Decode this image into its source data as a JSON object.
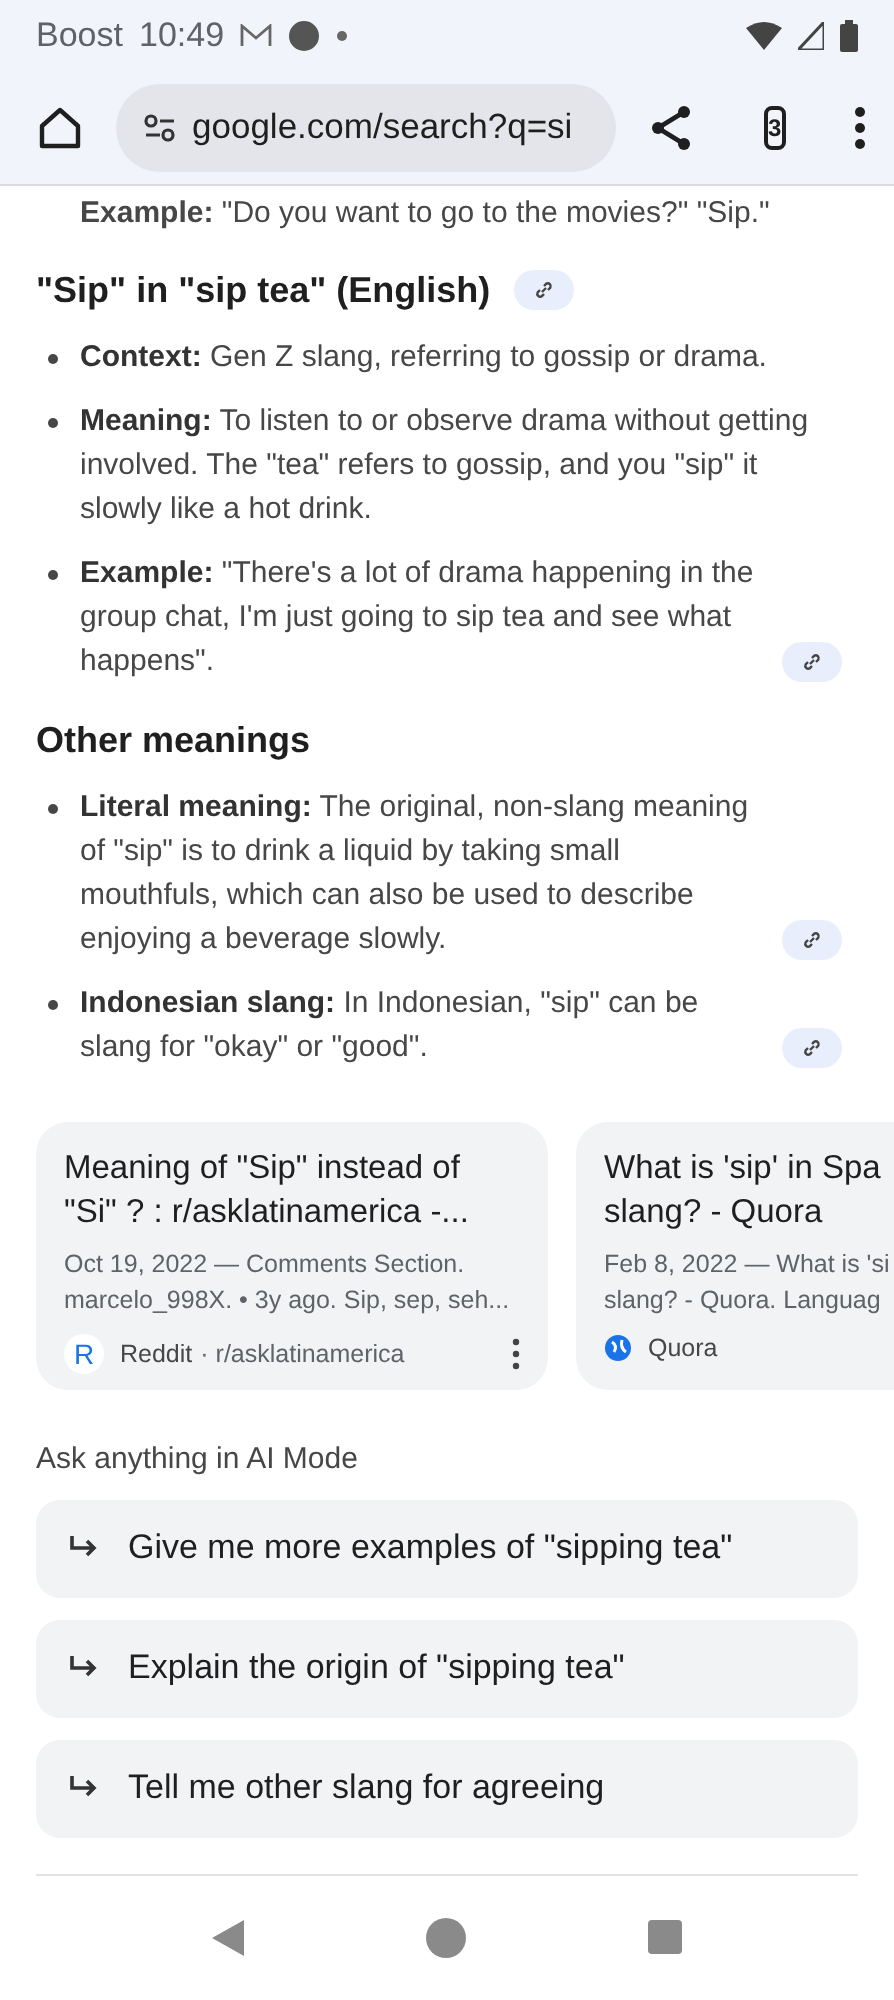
{
  "status_bar": {
    "carrier": "Boost",
    "time": "10:49"
  },
  "browser": {
    "url": "google.com/search?q=si",
    "tab_count": "3"
  },
  "partial_line": {
    "label": "Example:",
    "text": "\"Do you want to go to the movies?\" \"Sip.\""
  },
  "sections": [
    {
      "heading": "\"Sip\" in \"sip tea\" (English)",
      "link": true,
      "items": [
        {
          "label": "Context:",
          "text": "Gen Z slang, referring to gossip or drama.",
          "link": false
        },
        {
          "label": "Meaning:",
          "text": "To listen to or observe drama without getting involved. The \"tea\" refers to gossip, and you \"sip\" it slowly like a hot drink.",
          "link": false
        },
        {
          "label": "Example:",
          "text": "\"There's a lot of drama happening in the group chat, I'm just going to sip tea and see what happens\".",
          "link": true
        }
      ]
    },
    {
      "heading": "Other meanings",
      "link": false,
      "items": [
        {
          "label": "Literal meaning:",
          "text": "The original, non-slang meaning of \"sip\" is to drink a liquid by taking small mouthfuls, which can also be used to describe enjoying a beverage slowly.",
          "link": true
        },
        {
          "label": "Indonesian slang:",
          "text": "In Indonesian, \"sip\" can be slang for \"okay\" or \"good\".",
          "link": true
        }
      ]
    }
  ],
  "cards": [
    {
      "title": [
        "Meaning of \"Sip\" instead of",
        "\"Si\" ? : r/asklatinamerica -..."
      ],
      "snippet": [
        "Oct 19, 2022 — Comments Section.",
        "marcelo_998X. • 3y ago. Sip, sep, seh..."
      ],
      "source": "Reddit",
      "source_path": "· r/asklatinamerica",
      "favicon": "R",
      "kind": "letter",
      "more_button": true
    },
    {
      "title": [
        "What is 'sip' in Spa",
        "slang? - Quora"
      ],
      "snippet": [
        "Feb 8, 2022 — What is 'si",
        "slang? - Quora. Languag"
      ],
      "source": "Quora",
      "kind": "globe"
    }
  ],
  "ai_mode": {
    "heading": "Ask anything in AI Mode",
    "suggestions": [
      "Give me more examples of \"sipping tea\"",
      "Explain the origin of \"sipping tea\"",
      "Tell me other slang for agreeing"
    ]
  }
}
